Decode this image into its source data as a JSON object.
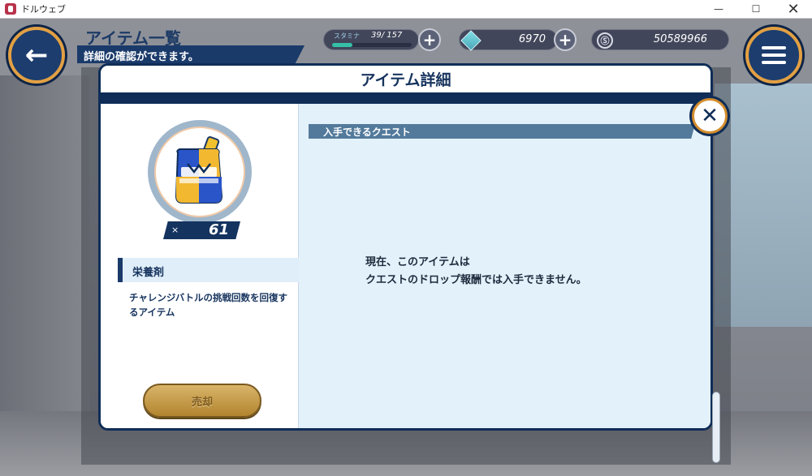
{
  "window": {
    "title": "ドルウェブ",
    "minimize": "—",
    "maximize": "☐",
    "close": "✕"
  },
  "header": {
    "page_title": "アイテム一覧",
    "page_subtitle": "詳細の確認ができます。",
    "back_icon": "←"
  },
  "resources": {
    "stamina": {
      "label": "スタミナ",
      "current": "39",
      "max": "157",
      "display": "39/ 157",
      "fill_fraction": 0.25
    },
    "gems": "6970",
    "coins": "50589966",
    "coin_symbol": "Ⓢ",
    "plus": "+"
  },
  "modal": {
    "title": "アイテム詳細",
    "close_icon": "✕",
    "item": {
      "count_prefix": "×",
      "count": "61",
      "name": "栄養剤",
      "description": "チャレンジバトルの挑戦回数を回復するアイテム",
      "sell_label": "売却"
    },
    "quest": {
      "header": "入手できるクエスト",
      "message_line1": "現在、このアイテムは",
      "message_line2": "クエストのドロップ報酬では入手できません。"
    }
  },
  "colors": {
    "navy": "#0f2d57",
    "accent_orange": "#d48d2d",
    "right_panel_bg": "#e3f1fb",
    "quest_header": "#537a9b",
    "sell_gold": "#c49a4a"
  }
}
